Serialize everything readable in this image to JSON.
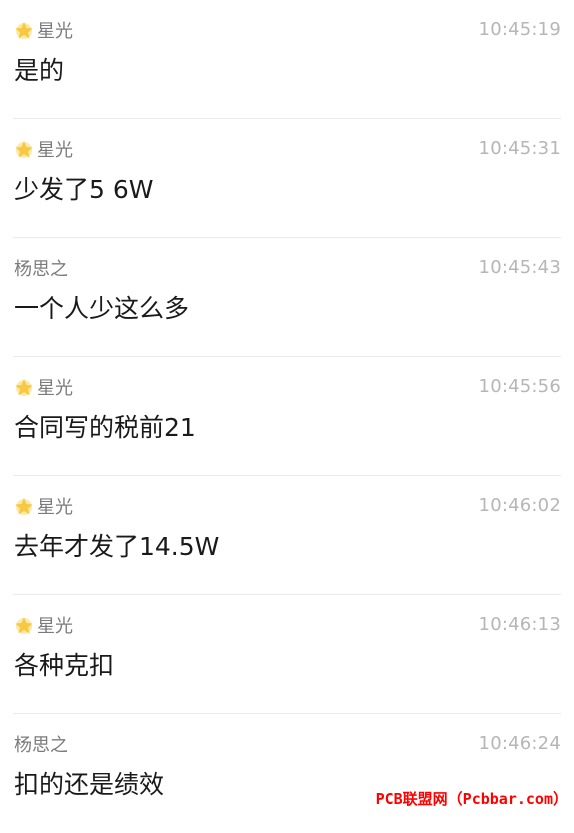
{
  "messages": [
    {
      "sender": "星光",
      "starred": true,
      "time": "10:45:19",
      "text": "是的"
    },
    {
      "sender": "星光",
      "starred": true,
      "time": "10:45:31",
      "text": "少发了5 6W"
    },
    {
      "sender": "杨思之",
      "starred": false,
      "time": "10:45:43",
      "text": "一个人少这么多"
    },
    {
      "sender": "星光",
      "starred": true,
      "time": "10:45:56",
      "text": "合同写的税前21"
    },
    {
      "sender": "星光",
      "starred": true,
      "time": "10:46:02",
      "text": "去年才发了14.5W"
    },
    {
      "sender": "星光",
      "starred": true,
      "time": "10:46:13",
      "text": "各种克扣"
    },
    {
      "sender": "杨思之",
      "starred": false,
      "time": "10:46:24",
      "text": "扣的还是绩效"
    }
  ],
  "watermark": "PCB联盟网（Pcbbar.com）",
  "colors": {
    "star": "#f7c843",
    "sender": "#7b7b7b",
    "time": "#b6b6b6",
    "text": "#1a1a1a",
    "divider": "#eaeaea",
    "watermark": "#ff0000"
  }
}
